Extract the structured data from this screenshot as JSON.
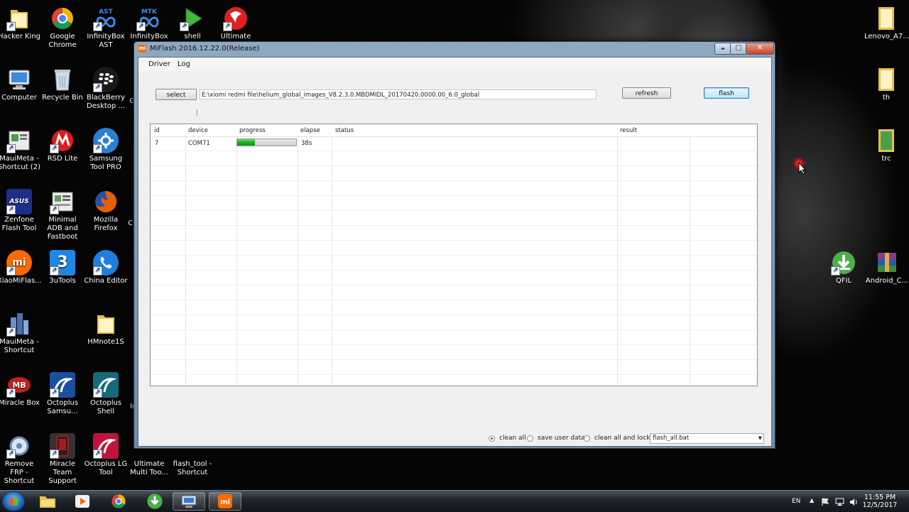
{
  "desktop": {
    "icons": [
      {
        "label": "Hacker King",
        "icon": "folder-icon",
        "color": "#e7c04a"
      },
      {
        "label": "Google Chrome",
        "icon": "chrome-icon",
        "color": "#db4437"
      },
      {
        "label": "InfinityBox AST",
        "icon": "infinitybox-ast-icon",
        "color": "#1e6fd9",
        "badge": "AST"
      },
      {
        "label": "InfinityBox",
        "icon": "infinitybox-mtk-icon",
        "color": "#1e6fd9",
        "badge": "MTK"
      },
      {
        "label": "shell",
        "icon": "shell-play-icon",
        "color": "#3fb93f"
      },
      {
        "label": "Ultimate",
        "icon": "ultimate-icon",
        "color": "#e02020"
      },
      {
        "label": "Computer",
        "icon": "computer-icon",
        "color": "#4a8fd8"
      },
      {
        "label": "Recycle Bin",
        "icon": "recycle-bin-icon",
        "color": "#9fb4c7"
      },
      {
        "label": "BlackBerry Desktop ...",
        "icon": "blackberry-icon",
        "color": "#222222"
      },
      {
        "label": "MauiMeta - Shortcut (2)",
        "icon": "mauimeta-icon",
        "color": "#4c9a4c"
      },
      {
        "label": "RSD Lite",
        "icon": "motorola-icon",
        "color": "#e01b1b"
      },
      {
        "label": "Samsung Tool PRO",
        "icon": "samsung-tool-icon",
        "color": "#2a7fd0"
      },
      {
        "label": "Zenfone Flash Tool",
        "icon": "asus-icon",
        "color": "#1d2f8a",
        "badge": "ASUS"
      },
      {
        "label": "Minimal ADB and Fastboot",
        "icon": "adb-icon",
        "color": "#5aa05a"
      },
      {
        "label": "Mozilla Firefox",
        "icon": "firefox-icon",
        "color": "#e66000"
      },
      {
        "label": "XiaoMiFlas...",
        "icon": "mi-icon",
        "color": "#ff6a00",
        "badge": "mi"
      },
      {
        "label": "3uTools",
        "icon": "3utools-icon",
        "color": "#1e88e5",
        "badge": "3"
      },
      {
        "label": "China Editor",
        "icon": "china-editor-icon",
        "color": "#1e7fe0"
      },
      {
        "label": "MauiMeta - Shortcut",
        "icon": "mauimeta-building-icon",
        "color": "#4a7fc0"
      },
      {
        "label": "HMnote1S",
        "icon": "folder-icon",
        "color": "#e7c04a"
      },
      {
        "label": "Miracle Box",
        "icon": "miracle-box-icon",
        "color": "#c81e1e"
      },
      {
        "label": "Octoplus Samsu...",
        "icon": "octoplus-icon",
        "color": "#1c4fa0"
      },
      {
        "label": "Octoplus Shell",
        "icon": "octoplus-shell-icon",
        "color": "#156a7a"
      },
      {
        "label": "Remove FRP - Shortcut",
        "icon": "remove-frp-icon",
        "color": "#d8d8d8"
      },
      {
        "label": "Miracle Team Support",
        "icon": "miracle-team-icon",
        "color": "#b01818"
      },
      {
        "label": "Octoplus LG Tool",
        "icon": "octoplus-lg-icon",
        "color": "#c0143c"
      },
      {
        "label": "Ultimate Multi Too...",
        "icon": "ultimate-multi-icon",
        "color": "#c03030"
      },
      {
        "label": "flash_tool - Shortcut",
        "icon": "flash-tool-icon",
        "color": "#3a8a3a"
      },
      {
        "label": "Lenovo_A7...",
        "icon": "folder-icon",
        "color": "#e7c04a"
      },
      {
        "label": "th",
        "icon": "folder-icon",
        "color": "#e7c04a"
      },
      {
        "label": "trc",
        "icon": "folder-green-icon",
        "color": "#4aa04a"
      },
      {
        "label": "QFIL",
        "icon": "qfil-icon",
        "color": "#4ab04a"
      },
      {
        "label": "Android_C...",
        "icon": "winrar-icon",
        "color": "#7a2a7a"
      }
    ],
    "partial_labels": [
      "G",
      "Ci",
      "Ir"
    ]
  },
  "window": {
    "title": "MiFlash 2016.12.22.0(Release)",
    "controls": {
      "minimize": "▬",
      "maximize": "▢",
      "close": "✕"
    },
    "menu": [
      "Driver",
      "Log"
    ],
    "select_label": "select",
    "path_value": "E:\\xiomi redmi file\\helium_global_images_V8.2.3.0.MBDMIDL_20170420.0000.00_6.0_global",
    "refresh_label": "refresh",
    "flash_label": "flash",
    "grid": {
      "headers": [
        "id",
        "device",
        "progress",
        "elapse",
        "status",
        "result"
      ],
      "rows": [
        {
          "id": "7",
          "device": "COM71",
          "progress": 0.3,
          "elapse": "38s",
          "status": "",
          "result": ""
        }
      ]
    },
    "options": {
      "clean_all": "clean all",
      "save_user_data": "save user data",
      "clean_all_and_lock": "clean all and lock",
      "selected": "clean_all",
      "script": "flash_all.bat"
    }
  },
  "taskbar": {
    "language": "EN",
    "time": "11:55 PM",
    "date": "12/5/2017",
    "apps": [
      "explorer-icon",
      "media-player-icon",
      "chrome-icon",
      "qfil-icon",
      "network-tool-icon",
      "mi-icon"
    ]
  },
  "accent_green": "#18b418"
}
